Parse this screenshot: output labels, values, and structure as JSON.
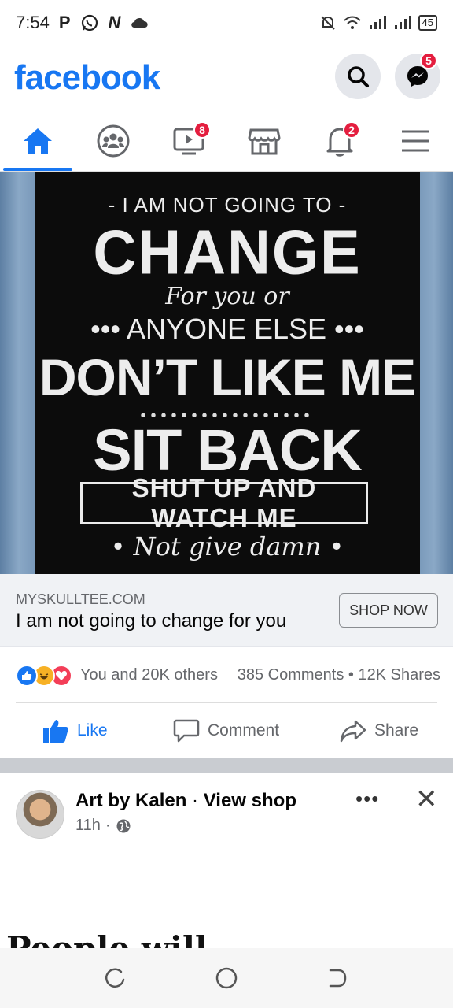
{
  "status": {
    "time": "7:54",
    "left_glyphs": [
      "P",
      "N"
    ],
    "battery": "45"
  },
  "header": {
    "logo": "facebook",
    "messenger_badge": "5"
  },
  "tabs": [
    {
      "name": "home",
      "badge": ""
    },
    {
      "name": "groups",
      "badge": ""
    },
    {
      "name": "watch",
      "badge": "8"
    },
    {
      "name": "marketplace",
      "badge": ""
    },
    {
      "name": "notifications",
      "badge": "2"
    },
    {
      "name": "menu",
      "badge": ""
    }
  ],
  "ad": {
    "image_lines": {
      "line1": "- I AM NOT GOING TO -",
      "line2": "CHANGE",
      "line3": "For you or",
      "line4": "••• ANYONE ELSE •••",
      "line5": "DON’T LIKE ME",
      "line6": "SIT BACK",
      "line7": "SHUT UP AND WATCH ME",
      "line8": "• Not give damn •"
    },
    "domain": "MYSKULLTEE.COM",
    "title": "I am not going to change for you",
    "cta": "SHOP NOW"
  },
  "reactions": {
    "summary": "You and 20K others",
    "comments": "385 Comments",
    "shares": "12K Shares",
    "separator": "•"
  },
  "actions": {
    "like": "Like",
    "comment": "Comment",
    "share": "Share"
  },
  "next_post": {
    "author": "Art by Kalen",
    "dot": "·",
    "view_shop": "View shop",
    "time": "11h",
    "meta_dot": "·",
    "more": "•••",
    "close": "✕",
    "cut_text": "People will …"
  },
  "colors": {
    "brand": "#1877f2",
    "badge": "#e41e3f",
    "secondary_text": "#65676b"
  }
}
